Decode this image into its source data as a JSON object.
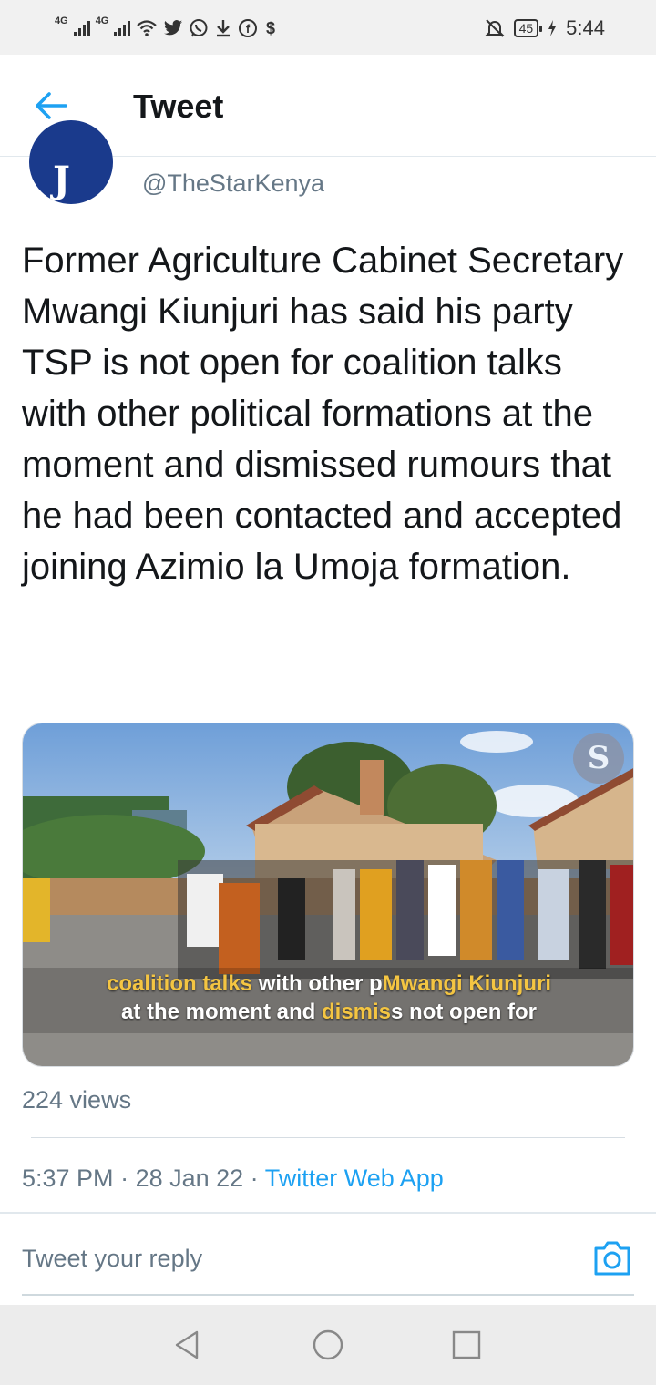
{
  "status_bar": {
    "network_1": "4G",
    "network_2": "4G",
    "battery": "45",
    "time": "5:44",
    "icons": [
      "signal-icon",
      "wifi-icon",
      "twitter-icon",
      "whatsapp-icon",
      "download-icon",
      "facebook-icon",
      "dollar-icon",
      "mute-icon",
      "charging-icon"
    ]
  },
  "header": {
    "title": "Tweet"
  },
  "tweet": {
    "handle": "@TheStarKenya",
    "text": "Former Agriculture Cabinet Secretary Mwangi Kiunjuri has said his party TSP is not open for coalition talks with other political formations at the moment and dismissed rumours that he had been contacted and accepted joining Azimio la Umoja formation.",
    "media": {
      "caption_line1": [
        {
          "text": "coalition talks ",
          "highlight": true
        },
        {
          "text": "with other p",
          "highlight": false
        },
        {
          "text": "Mwangi Kiunjuri",
          "highlight": true
        }
      ],
      "caption_line2": [
        {
          "text": "at the moment and ",
          "highlight": false
        },
        {
          "text": "dismis",
          "highlight": true
        },
        {
          "text": "s not open for",
          "highlight": false
        }
      ]
    },
    "views": "224 views",
    "time": "5:37 PM",
    "separator": " · ",
    "date": "28 Jan 22",
    "source": "Twitter Web App"
  },
  "reply": {
    "placeholder": "Tweet your reply"
  },
  "colors": {
    "accent": "#1da1f2",
    "text": "#14171a",
    "muted": "#657786",
    "highlight": "#f4c542"
  }
}
